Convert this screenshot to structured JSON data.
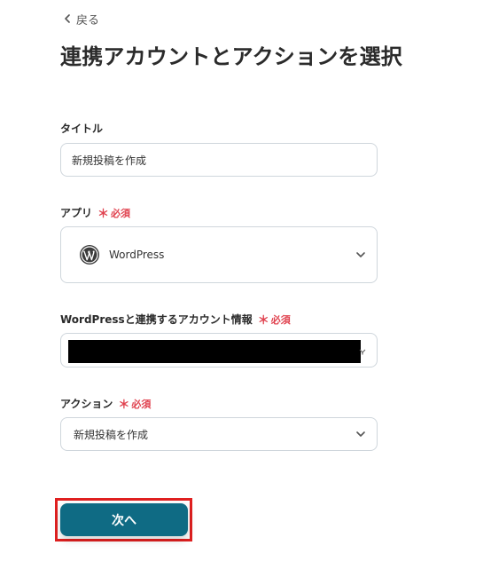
{
  "back": {
    "label": "戻る"
  },
  "page": {
    "title": "連携アカウントとアクションを選択"
  },
  "required_mark": "＊",
  "required_text": "必須",
  "fields": {
    "title": {
      "label": "タイトル",
      "value": "新規投稿を作成"
    },
    "app": {
      "label": "アプリ",
      "value": "WordPress"
    },
    "account": {
      "label": "WordPressと連携するアカウント情報"
    },
    "action": {
      "label": "アクション",
      "value": "新規投稿を作成"
    }
  },
  "next_button": {
    "label": "次へ"
  },
  "colors": {
    "primary": "#0f6b84",
    "required": "#e0424f",
    "highlight": "#e02020",
    "border": "#cfd6dc"
  },
  "icons": {
    "back": "chevron-left-icon",
    "app": "wordpress-logo-icon",
    "dropdown": "chevron-down-icon",
    "account_field": "pin-icon"
  }
}
